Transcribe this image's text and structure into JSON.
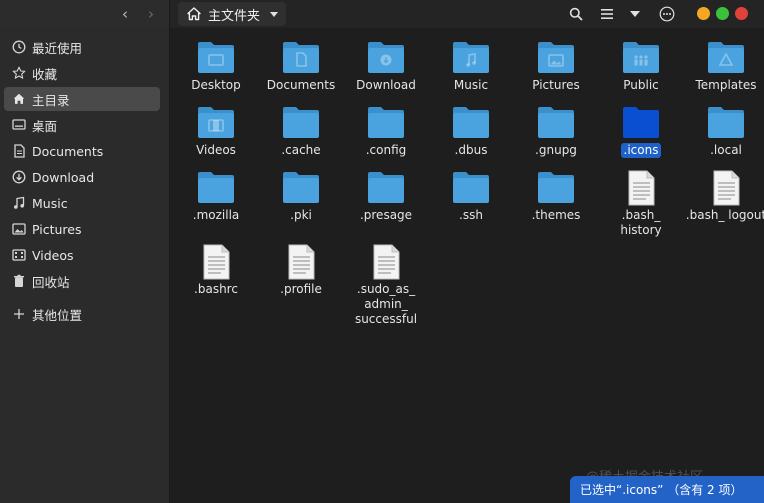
{
  "header": {
    "path_label": "主文件夹"
  },
  "sidebar": {
    "items": [
      {
        "label": "最近使用",
        "icon": "clock-icon"
      },
      {
        "label": "收藏",
        "icon": "star-icon"
      },
      {
        "label": "主目录",
        "icon": "home-icon",
        "active": true
      },
      {
        "label": "桌面",
        "icon": "desktop-icon"
      },
      {
        "label": "Documents",
        "icon": "document-icon"
      },
      {
        "label": "Download",
        "icon": "download-icon"
      },
      {
        "label": "Music",
        "icon": "music-icon"
      },
      {
        "label": "Pictures",
        "icon": "picture-icon"
      },
      {
        "label": "Videos",
        "icon": "video-icon"
      },
      {
        "label": "回收站",
        "icon": "trash-icon"
      },
      {
        "label": "其他位置",
        "icon": "plus-icon"
      }
    ]
  },
  "files": [
    {
      "name": "Desktop",
      "type": "folder",
      "emblem": "desktop"
    },
    {
      "name": "Documents",
      "type": "folder",
      "emblem": "document"
    },
    {
      "name": "Download",
      "type": "folder",
      "emblem": "download"
    },
    {
      "name": "Music",
      "type": "folder",
      "emblem": "music"
    },
    {
      "name": "Pictures",
      "type": "folder",
      "emblem": "picture"
    },
    {
      "name": "Public",
      "type": "folder",
      "emblem": "people"
    },
    {
      "name": "Templates",
      "type": "folder",
      "emblem": "template"
    },
    {
      "name": "Videos",
      "type": "folder",
      "emblem": "video"
    },
    {
      "name": ".cache",
      "type": "folder"
    },
    {
      "name": ".config",
      "type": "folder"
    },
    {
      "name": ".dbus",
      "type": "folder"
    },
    {
      "name": ".gnupg",
      "type": "folder"
    },
    {
      "name": ".icons",
      "type": "folder",
      "selected": true
    },
    {
      "name": ".local",
      "type": "folder"
    },
    {
      "name": ".mozilla",
      "type": "folder"
    },
    {
      "name": ".pki",
      "type": "folder"
    },
    {
      "name": ".presage",
      "type": "folder"
    },
    {
      "name": ".ssh",
      "type": "folder"
    },
    {
      "name": ".themes",
      "type": "folder"
    },
    {
      "name": ".bash_ history",
      "type": "file"
    },
    {
      "name": ".bash_ logout",
      "type": "file"
    },
    {
      "name": ".bashrc",
      "type": "file"
    },
    {
      "name": ".profile",
      "type": "file"
    },
    {
      "name": ".sudo_as_ admin_ successful",
      "type": "file"
    }
  ],
  "status_text": "已选中“.icons” （含有 2 项）",
  "watermark": "@稀土掘金技术社区",
  "colors": {
    "folder": "#4aa3df",
    "folder_tab": "#3b8fcb",
    "selected_folder": "#0a4fd1",
    "selection": "#1e62c9",
    "close": "#e0413a",
    "minimize": "#f5a623",
    "maximize": "#3cc13b"
  }
}
